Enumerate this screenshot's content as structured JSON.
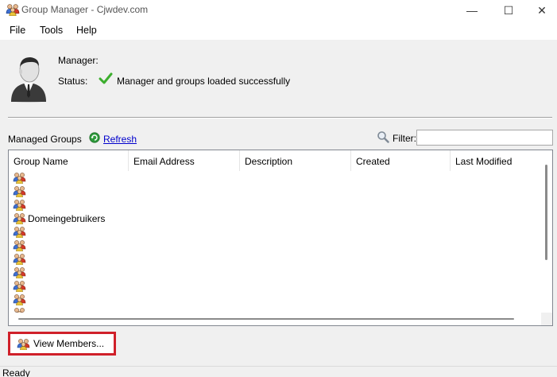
{
  "window": {
    "title": "Group Manager - Cjwdev.com",
    "minimize": "—",
    "maximize": "☐",
    "close": "✕"
  },
  "menu": {
    "file": "File",
    "tools": "Tools",
    "help": "Help"
  },
  "info": {
    "manager_label": "Manager:",
    "manager_value": "",
    "status_label": "Status:",
    "status_text": "Manager and groups loaded successfully"
  },
  "groups": {
    "label": "Managed Groups",
    "refresh_label": "Refresh",
    "filter_label": "Filter:",
    "filter_value": ""
  },
  "table": {
    "columns": [
      "Group Name",
      "Email Address",
      "Description",
      "Created",
      "Last Modified"
    ],
    "rows": [
      {
        "name": ""
      },
      {
        "name": ""
      },
      {
        "name": ""
      },
      {
        "name": "Domeingebruikers"
      },
      {
        "name": ""
      },
      {
        "name": ""
      },
      {
        "name": ""
      },
      {
        "name": ""
      },
      {
        "name": ""
      },
      {
        "name": ""
      },
      {
        "name": ""
      }
    ]
  },
  "actions": {
    "view_members": "View Members..."
  },
  "status_bar": {
    "text": "Ready"
  },
  "colors": {
    "highlight_border": "#d0202a",
    "link": "#0000cc",
    "check": "#3cae2e"
  }
}
